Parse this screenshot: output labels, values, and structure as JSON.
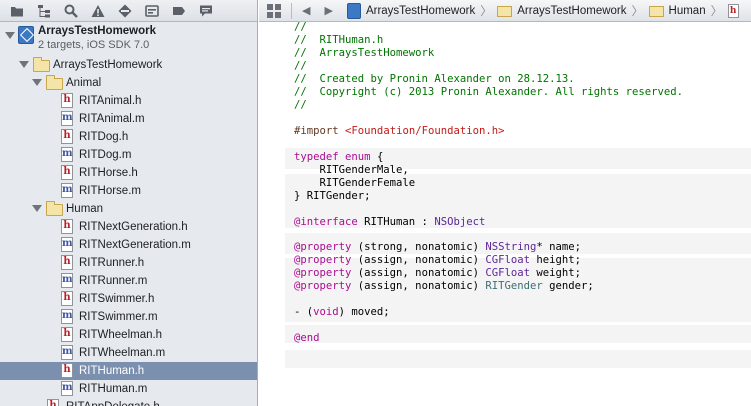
{
  "toolbar": {
    "icons": [
      "folder-icon",
      "hierarchy-icon",
      "search-icon",
      "warning-icon",
      "breakpoint-icon",
      "debug-icon",
      "label-icon",
      "log-icon"
    ]
  },
  "navigator": {
    "project": {
      "name": "ArraysTestHomework",
      "subtitle": "2 targets, iOS SDK 7.0"
    },
    "group": {
      "name": "ArraysTestHomework"
    },
    "animal_group": {
      "name": "Animal"
    },
    "animal_files": [
      {
        "name": "RITAnimal.h",
        "type": "h"
      },
      {
        "name": "RITAnimal.m",
        "type": "m"
      },
      {
        "name": "RITDog.h",
        "type": "h"
      },
      {
        "name": "RITDog.m",
        "type": "m"
      },
      {
        "name": "RITHorse.h",
        "type": "h"
      },
      {
        "name": "RITHorse.m",
        "type": "m"
      }
    ],
    "human_group": {
      "name": "Human"
    },
    "human_files": [
      {
        "name": "RITNextGeneration.h",
        "type": "h"
      },
      {
        "name": "RITNextGeneration.m",
        "type": "m"
      },
      {
        "name": "RITRunner.h",
        "type": "h"
      },
      {
        "name": "RITRunner.m",
        "type": "m"
      },
      {
        "name": "RITSwimmer.h",
        "type": "h"
      },
      {
        "name": "RITSwimmer.m",
        "type": "m"
      },
      {
        "name": "RITWheelman.h",
        "type": "h"
      },
      {
        "name": "RITWheelman.m",
        "type": "m"
      },
      {
        "name": "RITHuman.h",
        "type": "h"
      },
      {
        "name": "RITHuman.m",
        "type": "m"
      }
    ],
    "tail_file": {
      "name": "RITAppDelegate.h",
      "type": "h"
    },
    "selected_file": "RITHuman.h"
  },
  "jumpbar": {
    "back_icon": "◀",
    "forward_icon": "▶",
    "crumbs": [
      "ArraysTestHomework",
      "ArraysTestHomework",
      "Human"
    ],
    "file_icon_letter": "h",
    "chevron": "〉"
  },
  "code": {
    "l01": "//",
    "l02": "//  RITHuman.h",
    "l03": "//  ArraysTestHomework",
    "l04": "//",
    "l05": "//  Created by Pronin Alexander on 28.12.13.",
    "l06": "//  Copyright (c) 2013 Pronin Alexander. All rights reserved.",
    "l07": "//",
    "import_kw": "#import",
    "import_path": "<Foundation/Foundation.h>",
    "typedef_kw": "typedef",
    "enum_kw": "enum",
    "enum_open": " {",
    "enum_v1": "    RITGenderMale,",
    "enum_v2": "    RITGenderFemale",
    "enum_close": "} RITGender;",
    "interface_kw": "@interface",
    "interface_name": " RITHuman : ",
    "interface_super": "NSObject",
    "prop_kw": "@property",
    "p1_attr": " (strong, nonatomic) ",
    "p1_type": "NSString",
    "p1_rest": "* name;",
    "p2_attr": " (assign, nonatomic) ",
    "p2_type": "CGFloat",
    "p2_rest": " height;",
    "p3_attr": " (assign, nonatomic) ",
    "p3_type": "CGFloat",
    "p3_rest": " weight;",
    "p4_attr": " (assign, nonatomic) ",
    "p4_type": "RITGender",
    "p4_rest": " gender;",
    "method_a": "- (",
    "method_void": "void",
    "method_b": ") moved;",
    "end_kw": "@end"
  },
  "colors": {
    "comment": "#007400",
    "keyword": "#aa0d91",
    "string": "#c41a16",
    "type": "#5c2699",
    "project_type": "#3f6e74",
    "selection": "#7b8fae"
  }
}
